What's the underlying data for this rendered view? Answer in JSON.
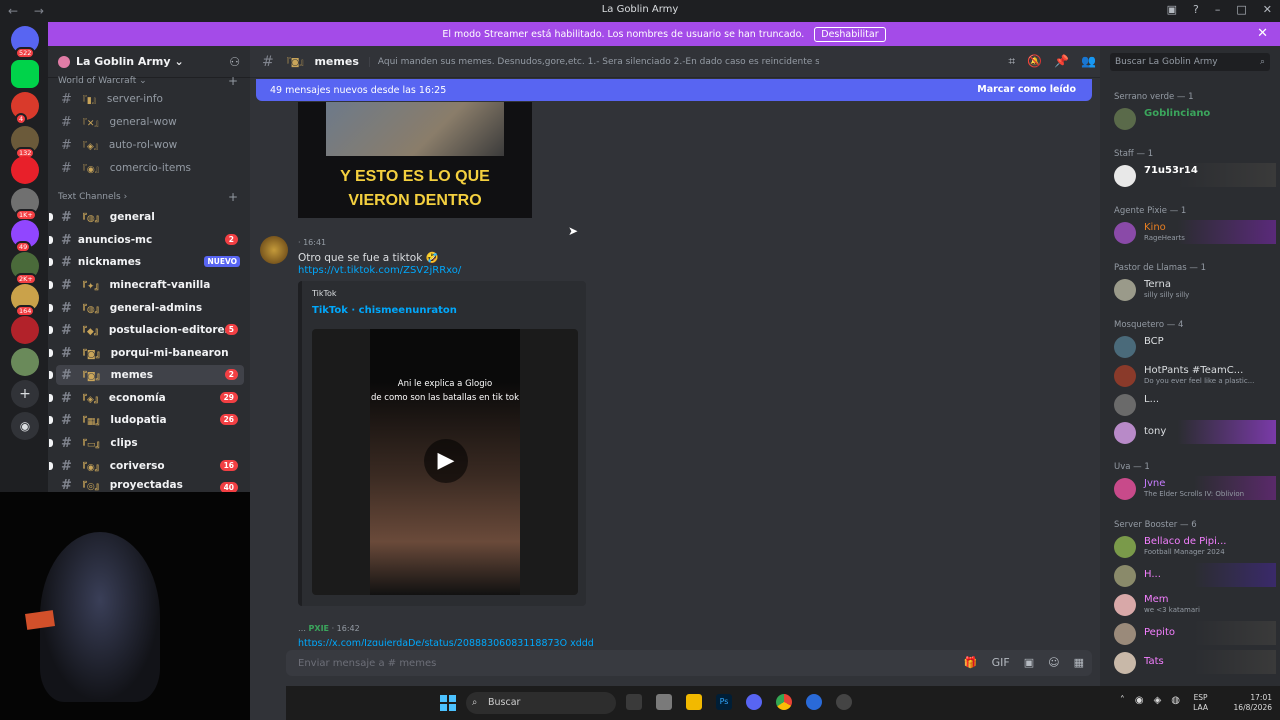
{
  "window": {
    "title": "La Goblin Army"
  },
  "banner": {
    "text": "El modo Streamer está habilitado. Los nombres de usuario se han truncado.",
    "button": "Deshabilitar"
  },
  "server_badges": [
    "522",
    "4",
    "132",
    "1K+",
    "49",
    "2K+",
    "164"
  ],
  "guild": {
    "name": "La Goblin Army"
  },
  "sidebar": {
    "top_category": "World of Warcraft",
    "top_channels": [
      {
        "label": "server-info"
      },
      {
        "label": "general-wow"
      },
      {
        "label": "auto-rol-wow"
      },
      {
        "label": "comercio-items"
      }
    ],
    "text_category": "Text Channels",
    "channels": [
      {
        "label": "general",
        "count": ""
      },
      {
        "label": "anuncios-mc",
        "count": "2"
      },
      {
        "label": "nicknames",
        "tag": "NUEVO"
      },
      {
        "label": "minecraft-vanilla",
        "count": ""
      },
      {
        "label": "general-admins",
        "count": ""
      },
      {
        "label": "postulacion-editores",
        "count": "5"
      },
      {
        "label": "porqui-mi-banearon",
        "count": ""
      },
      {
        "label": "memes",
        "count": "2"
      },
      {
        "label": "economía",
        "count": "29"
      },
      {
        "label": "ludopatia",
        "count": "26"
      },
      {
        "label": "clips",
        "count": ""
      },
      {
        "label": "coriverso",
        "count": "16"
      },
      {
        "label": "proyectadas",
        "count": "40"
      }
    ]
  },
  "channel": {
    "name": "memes",
    "topic": "Aqui manden sus memes. Desnudos,gore,etc. 1.- Sera silenciado 2.-En dado caso es reincidente sera baneado"
  },
  "new_messages": {
    "text": "49 mensajes nuevos desde las 16:25",
    "action": "Marcar como leído"
  },
  "messages": {
    "image_caption_1": "Y ESTO ES LO QUE",
    "image_caption_2": "VIERON DENTRO",
    "msg1_time": "16:41",
    "msg1_text": "Otro que se fue a tiktok 🤣",
    "msg1_link": "https://vt.tiktok.com/ZSV2jRRxo/",
    "embed_provider": "TikTok",
    "embed_title": "TikTok · chismeenunraton",
    "video_caption_1": "Ani le explica a Glogio",
    "video_caption_2": "de como son las batallas en tik tok",
    "msg2_tag": "PXIE",
    "msg2_time": "16:42",
    "msg2_link": "https://x.com/IzquierdaDe/status/20888306083118873O xddd"
  },
  "composer": {
    "placeholder": "Enviar mensaje a #  memes"
  },
  "search": {
    "placeholder": "Buscar La Goblin Army"
  },
  "members": {
    "groups": [
      {
        "title": "Serrano verde — 1",
        "members": [
          {
            "name": "Goblinciano",
            "status": "",
            "color": "#3ba55c"
          }
        ]
      },
      {
        "title": "Staff — 1",
        "members": [
          {
            "name": "71u53r14",
            "status": "",
            "color": "#ffffff"
          }
        ]
      },
      {
        "title": "Agente Pixie — 1",
        "members": [
          {
            "name": "Kino",
            "status": "RageHearts",
            "color": "#e67e22"
          }
        ]
      },
      {
        "title": "Pastor de Llamas — 1",
        "members": [
          {
            "name": "Terna",
            "status": "silly silly silly",
            "color": "#dbdee1"
          }
        ]
      },
      {
        "title": "Mosquetero — 4",
        "members": [
          {
            "name": "BCP",
            "status": "",
            "color": "#dbdee1"
          },
          {
            "name": "HotPants #TeamC...",
            "status": "Do you ever feel like a plastic...",
            "color": "#dbdee1"
          },
          {
            "name": "L...",
            "status": "",
            "color": "#dbdee1"
          },
          {
            "name": "tony",
            "status": "",
            "color": "#dbdee1"
          }
        ]
      },
      {
        "title": "Uva — 1",
        "members": [
          {
            "name": "Jvne",
            "status": "The Elder Scrolls IV: Oblivion",
            "color": "#c77dff"
          }
        ]
      },
      {
        "title": "Server Booster — 6",
        "members": [
          {
            "name": "Bellaco de Pipi...",
            "status": "Football Manager 2024",
            "color": "#f47fff"
          },
          {
            "name": "H...",
            "status": "",
            "color": "#f47fff"
          },
          {
            "name": "Mem",
            "status": "we <3 katamari",
            "color": "#f47fff"
          },
          {
            "name": "Pepito",
            "status": "",
            "color": "#f47fff"
          },
          {
            "name": "Tats",
            "status": "",
            "color": "#f47fff"
          }
        ]
      }
    ]
  },
  "taskbar": {
    "search": "Buscar",
    "lang": "ESP",
    "lang2": "LAA",
    "time": "17:01",
    "date": "16/8/2026"
  }
}
